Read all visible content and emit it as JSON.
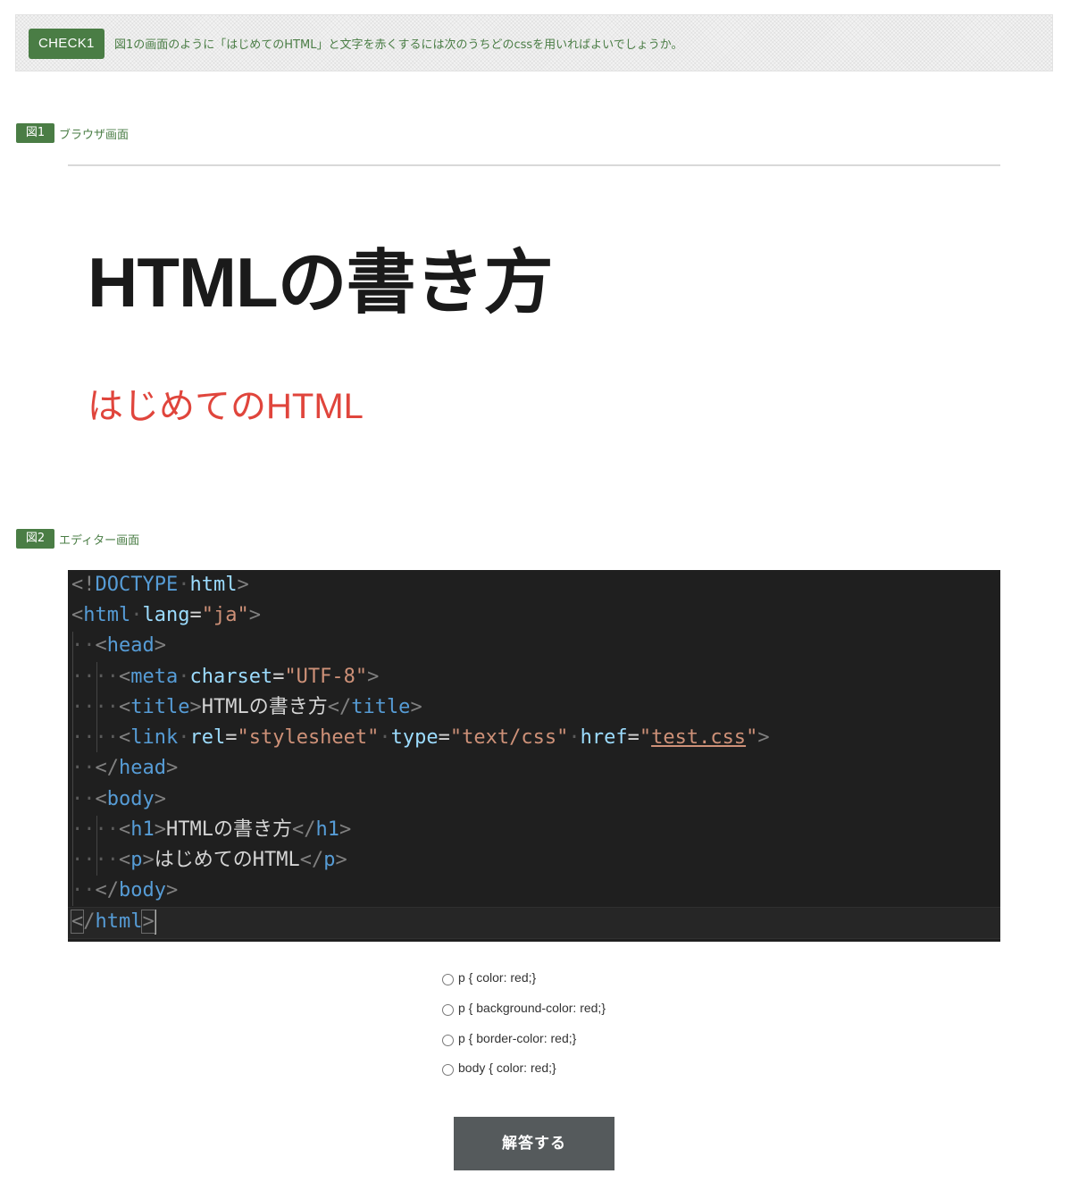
{
  "check": {
    "badge": "CHECK1",
    "question": "図1の画面のように「はじめてのHTML」と文字を赤くするには次のうちどのcssを用いればよいでしょうか。"
  },
  "figure1": {
    "badge": "図1",
    "caption": "ブラウザ画面",
    "h1": "HTMLの書き方",
    "p": "はじめてのHTML"
  },
  "figure2": {
    "badge": "図2",
    "caption": "エディター画面"
  },
  "code": {
    "l1": {
      "open": "<!",
      "kw": "DOCTYPE",
      "dot": "·",
      "name": "html",
      "close": ">"
    },
    "l2": {
      "open": "<",
      "tag": "html",
      "dot": "·",
      "attr": "lang",
      "eq": "=",
      "val": "\"ja\"",
      "close": ">"
    },
    "l3": {
      "dots": "··",
      "open": "<",
      "tag": "head",
      "close": ">"
    },
    "l4": {
      "dots": "····",
      "open": "<",
      "tag": "meta",
      "dot": "·",
      "attr": "charset",
      "eq": "=",
      "val": "\"UTF-8\"",
      "close": ">"
    },
    "l5": {
      "dots": "····",
      "open": "<",
      "tag": "title",
      "close": ">",
      "text": "HTMLの書き方",
      "open2": "</",
      "tag2": "title",
      "close2": ">"
    },
    "l6": {
      "dots": "····",
      "open": "<",
      "tag": "link",
      "dot1": "·",
      "attr1": "rel",
      "eq1": "=",
      "val1": "\"stylesheet\"",
      "dot2": "·",
      "attr2": "type",
      "eq2": "=",
      "val2": "\"text/css\"",
      "dot3": "·",
      "attr3": "href",
      "eq3": "=",
      "q1": "\"",
      "url": "test.css",
      "q2": "\"",
      "close": ">"
    },
    "l7": {
      "dots": "··",
      "open": "</",
      "tag": "head",
      "close": ">"
    },
    "l8": {
      "dots": "··",
      "open": "<",
      "tag": "body",
      "close": ">"
    },
    "l9": {
      "dots": "····",
      "open": "<",
      "tag": "h1",
      "close": ">",
      "text": "HTMLの書き方",
      "open2": "</",
      "tag2": "h1",
      "close2": ">"
    },
    "l10": {
      "dots": "····",
      "open": "<",
      "tag": "p",
      "close": ">",
      "text": "はじめてのHTML",
      "open2": "</",
      "tag2": "p",
      "close2": ">"
    },
    "l11": {
      "dots": "··",
      "open": "</",
      "tag": "body",
      "close": ">"
    },
    "l12": {
      "open": "<",
      "slash": "/",
      "tag": "html",
      "close": ">"
    }
  },
  "options": [
    "p { color: red;}",
    "p { background-color: red;}",
    "p { border-color: red;}",
    "body { color: red;}"
  ],
  "submit_label": "解答する",
  "colors": {
    "accent_green": "#4a7d45",
    "editor_bg": "#1f1f1f",
    "red_text": "#e0453c",
    "button_bg": "#555a5c"
  }
}
